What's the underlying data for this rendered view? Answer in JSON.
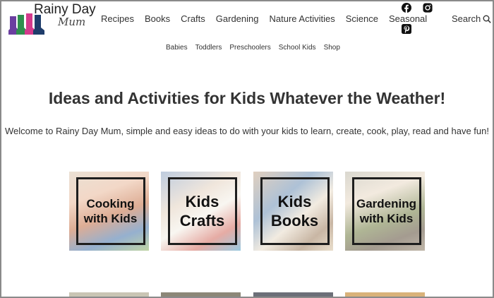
{
  "logo": {
    "title": "Rainy Day",
    "subtitle": "Mum"
  },
  "main_nav": [
    "Recipes",
    "Books",
    "Crafts",
    "Gardening",
    "Nature Activities",
    "Science",
    "Seasonal"
  ],
  "sub_nav": [
    "Babies",
    "Toddlers",
    "Preschoolers",
    "School Kids",
    "Shop"
  ],
  "social_icons": [
    "facebook-icon",
    "instagram-icon",
    "pinterest-icon"
  ],
  "search": {
    "label": "Search"
  },
  "hero": {
    "title": "Ideas and Activities for Kids Whatever the Weather!",
    "text": "Welcome to Rainy Day Mum, simple and easy ideas to do with your kids to learn, create, cook, play, read and have fun!"
  },
  "tiles": [
    {
      "label": "Cooking with Kids"
    },
    {
      "label": "Kids Crafts"
    },
    {
      "label": "Kids Books"
    },
    {
      "label": "Gardening with Kids"
    }
  ],
  "colors": {
    "text": "#333333",
    "frame": "#8a8a8a",
    "tile_border": "#1e1e1e"
  }
}
